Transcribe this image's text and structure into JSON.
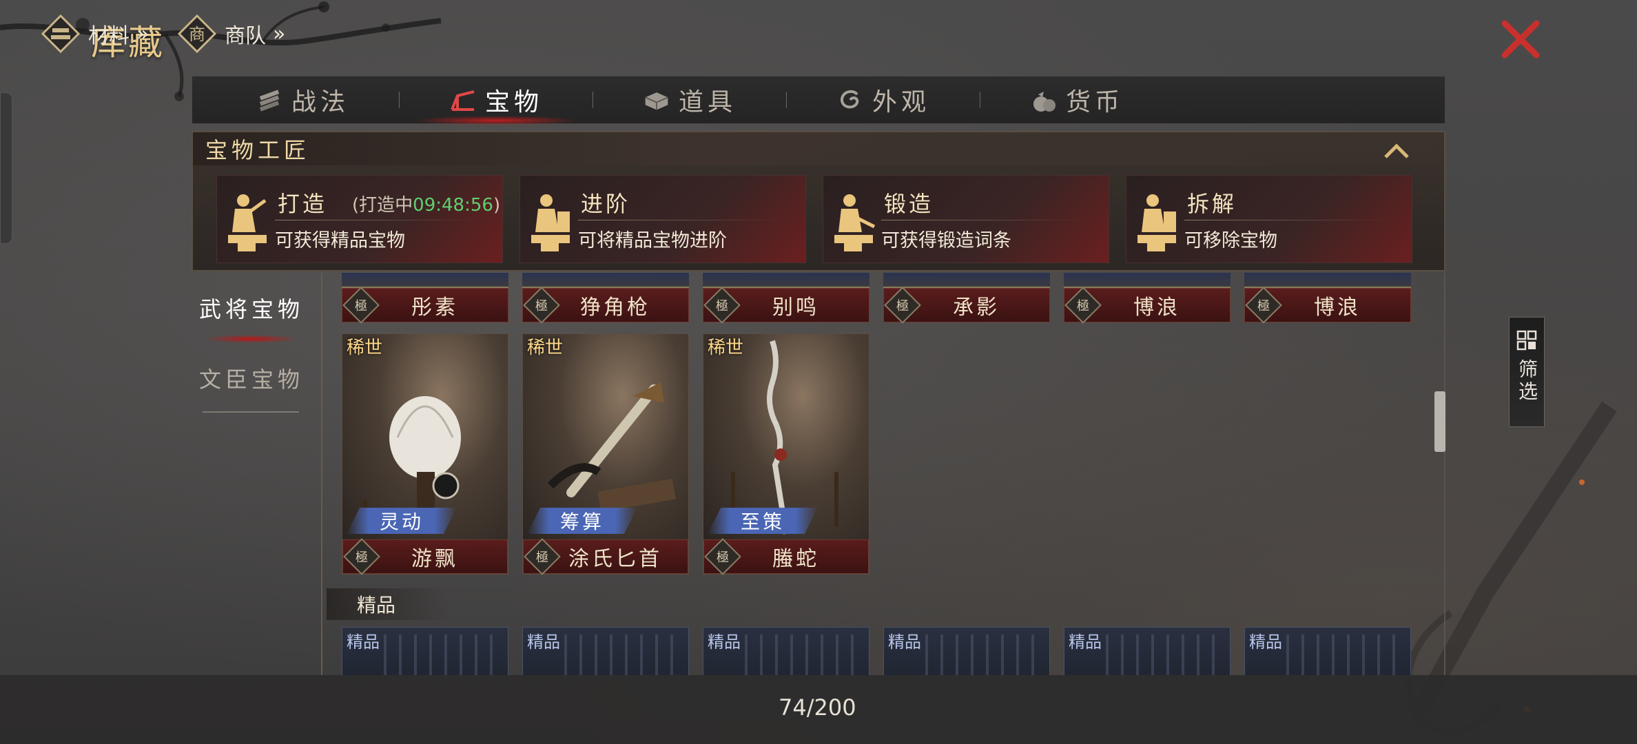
{
  "title": "库藏",
  "tabs": [
    {
      "label": "战法",
      "icon": "scroll-bundle-icon",
      "active": false
    },
    {
      "label": "宝物",
      "icon": "treasure-frame-icon",
      "active": true
    },
    {
      "label": "道具",
      "icon": "chest-icon",
      "active": false
    },
    {
      "label": "外观",
      "icon": "swirl-icon",
      "active": false
    },
    {
      "label": "货币",
      "icon": "money-bag-icon",
      "active": false
    }
  ],
  "craft": {
    "header": "宝物工匠",
    "cards": [
      {
        "title": "打造",
        "status_prefix": "(打造中",
        "timer": "09:48:56",
        "status_suffix": ")",
        "desc": "可获得精品宝物"
      },
      {
        "title": "进阶",
        "desc": "可将精品宝物进阶"
      },
      {
        "title": "锻造",
        "desc": "可获得锻造词条"
      },
      {
        "title": "拆解",
        "desc": "可移除宝物"
      }
    ]
  },
  "side": {
    "categories": [
      {
        "label": "武将宝物",
        "active": true
      },
      {
        "label": "文臣宝物",
        "active": false
      }
    ]
  },
  "grid": {
    "top_names": [
      "彤素",
      "狰角枪",
      "别鸣",
      "承影",
      "博浪",
      "博浪"
    ],
    "grade_glyph": "極",
    "items": [
      {
        "rarity": "稀世",
        "attribute": "灵动",
        "name": "游飘"
      },
      {
        "rarity": "稀世",
        "attribute": "筹算",
        "name": "涂氏匕首"
      },
      {
        "rarity": "稀世",
        "attribute": "至策",
        "name": "螣蛇"
      }
    ],
    "section_label": "精品",
    "fine_tag": "精品",
    "fine_count": 6
  },
  "filter": {
    "label": "筛选"
  },
  "bottom": {
    "materials": "材料",
    "caravan": "商队",
    "arrow": "»",
    "count": "74/200"
  },
  "colors": {
    "accent_gold": "#e7c98c",
    "close_red": "#c8302e",
    "timer_green": "#5fcf6f",
    "attribute_blue": "#4a66b4"
  }
}
